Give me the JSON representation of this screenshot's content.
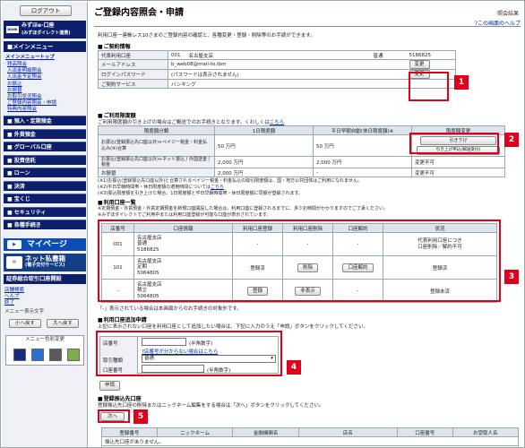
{
  "sidebar": {
    "logout": "ログアウト",
    "bank_logo": "BANK",
    "bank_name_1": "みずほe-口座",
    "bank_name_2": "(みずほダイレクト連携)",
    "menu_header": "■メインメニュー",
    "menu_top": "メインメニュートップ",
    "links": [
      "残高照会",
      "入出金明細照会",
      "入出金予定照会",
      "お振込",
      "お振替",
      "お取引状況照会",
      "ご登録内容照会・申請",
      "特典内容照会"
    ],
    "items": [
      "■ 預入・定期預金",
      "■ 外貨預金",
      "■ グローバル口座",
      "■ 投資信託",
      "■ ローン",
      "■ 決済",
      "■ 宝くじ",
      "■ セキュリティ",
      "■ 各種手続き"
    ],
    "mypage": "マイページ",
    "net_title": "ネット私書箱",
    "net_sub": "(電子交付サービス)",
    "syoken": "証券総合取引口座開設",
    "links2": [
      "店舗検索",
      "ヘルプ",
      "終了"
    ],
    "font_label": "メニュー表示文字",
    "small_btn": "小へ戻す",
    "large_btn": "大へ戻す",
    "color_label": "メニュー色彩変更",
    "swatches": [
      "#1b2a7a",
      "#2f6fcf",
      "#5a5a5a",
      "#7cae4a"
    ]
  },
  "main": {
    "title": "ご登録内容照会・申請",
    "page_code": "照会結果",
    "help": "?この画面のヘルプ",
    "intro": "利用口座一連帳レス10さまのご登録内容の確認と、各種変更・登録・削除等のお手続ができます。",
    "contract": {
      "heading": "ご契約情報",
      "rows": [
        {
          "label": "代表利用口座",
          "c1": "001",
          "c2": "名古屋支店",
          "c3": "普通",
          "c4": "5186825"
        },
        {
          "label": "メールアドレス",
          "c1": "b_web08@mail-to.ibm",
          "btn": "変更"
        },
        {
          "label": "ログインパスワード",
          "c1": "(パスワードは表示されません)",
          "btn": "変更"
        },
        {
          "label": "ご契約サービス",
          "c1": "バンキング"
        }
      ]
    },
    "limit": {
      "heading": "ご利用限度額",
      "note": "ご利用限度額の引き上げの場合はご郵送でのお手続きとなります。くわしくは",
      "note_link": "こちら",
      "headers": [
        "限度額分類",
        "1日限度額",
        "平日早朝自動(休日限度額)※",
        "限度額変更"
      ],
      "rows": [
        {
          "label": "お振込(登録振込先口座以外)+ペイジー税金・料金払込み(※)合算",
          "d1": "50 万円",
          "d2": "50 万円",
          "d3": "変更"
        },
        {
          "label": "お振込(登録振込先口座以外)+ネット振込 / 外国送金 / 税金",
          "d1": "2,000 万円",
          "d2": "2,000 万円",
          "d3": "変更不可"
        },
        {
          "label": "お振替",
          "d1": "2,000 万円",
          "d2": "-",
          "d3": "変更不可"
        }
      ],
      "sub_btn1": "引き下げ",
      "sub_btn2": "引き上げ申込(郵送受付)",
      "notes": [
        "(※1)お振込(登録振込先口座以外)と合算されるペイジー税金・料金払込の取引限度額は、国・地方公共団体はご利用になれません。",
        "(※2)平日早朝時間帯・休日限度額の適用時間については",
        "(※3)振込限度額を引き上げた場合、1日限度額と平日早朝時間帯・休日限度額に同額が登録されます。"
      ],
      "notes_link": "こちら"
    },
    "accounts": {
      "heading": "利用口座一覧",
      "note1": "※定期預金・外貨預金・外貨定期預金を新規口座開設した場合は、利用口座に登録されるまでに、多少お時間がかかりますのでご了承ください。",
      "note2": "※みずほダイレクトでご利用中または利用口座登録が可能な口座が表示されています。",
      "headers": [
        "店番号",
        "口座情報",
        "利用口座登録",
        "利用口座削除",
        "口座解約",
        "状況"
      ],
      "rows": [
        {
          "branch": "001",
          "info1": "名古屋支店",
          "info2": "普通",
          "info3": "5186825",
          "reg": "-",
          "del": "-",
          "close": "-",
          "status1": "代表利用口座につき",
          "status2": "口座削除／解約不可"
        },
        {
          "branch": "101",
          "info1": "名古屋支店",
          "info2": "定期",
          "info3": "5064805",
          "reg": "登録済",
          "del": "削除",
          "close": "口座解約",
          "status1": "登録済",
          "status2": ""
        },
        {
          "branch": "-",
          "info1": "名古屋支店",
          "info2": "積立",
          "info3": "5064805",
          "reg": "登録",
          "del": "非表示",
          "close": "-",
          "status1": "登録未済",
          "status2": ""
        }
      ],
      "footnote": "「-」表示されている場合は本画面からのお手続きの対象外です。"
    },
    "add": {
      "heading": "利用口座追加申請",
      "note": "上記に表示されない口座を利用口座として追加したい場合は、下記に入力のうえ「申請」ボタンをクリックしてください。",
      "branch_label": "店番号",
      "branch_hint": "(半角数字)",
      "branch_link": "?店番号が分からない場合はこちら",
      "type_label": "取引種類",
      "type_value": "普通",
      "acct_label": "口座番号",
      "acct_hint": "(半角数字)",
      "apply": "申請"
    },
    "transfer": {
      "heading": "登録振込先口座",
      "note": "登録振込先口座の削除またはニックネーム編集をする場合は「次へ」ボタンをクリックしてください。",
      "next": "次へ",
      "headers": [
        "登録番号",
        "ニックネーム",
        "金融機関名",
        "店名",
        "口座番号",
        "お受取人名"
      ],
      "empty": "振込先口座がありません。"
    },
    "callouts": [
      "1",
      "2",
      "3",
      "4",
      "5"
    ]
  },
  "accent": {
    "navy": "#0d1f6b",
    "red": "#e0001a",
    "blue": "#0b4cb5"
  }
}
